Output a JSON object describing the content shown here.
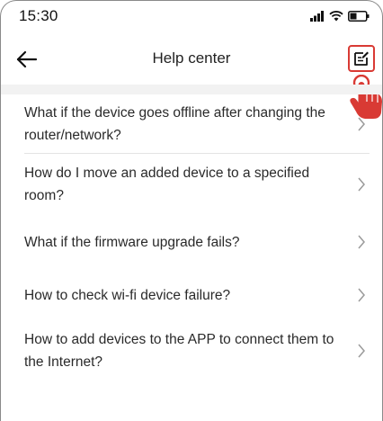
{
  "status_bar": {
    "time": "15:30",
    "icons": [
      "signal-icon",
      "wifi-icon",
      "battery-icon"
    ]
  },
  "nav": {
    "title": "Help center",
    "back_icon": "back-arrow-icon",
    "feedback_icon": "feedback-edit-icon"
  },
  "colors": {
    "highlight": "#d93a34",
    "band": "#f2f2f2",
    "divider": "#e3e3e3"
  },
  "faq": {
    "items": [
      {
        "question": "What if the device goes offline after changing the router/network?"
      },
      {
        "question": "How do I move an added device to a specified room?"
      },
      {
        "question": "What if the firmware upgrade fails?"
      },
      {
        "question": "How to check wi-fi device failure?"
      },
      {
        "question": "How to add devices to the APP to connect them to the Internet?"
      }
    ]
  }
}
